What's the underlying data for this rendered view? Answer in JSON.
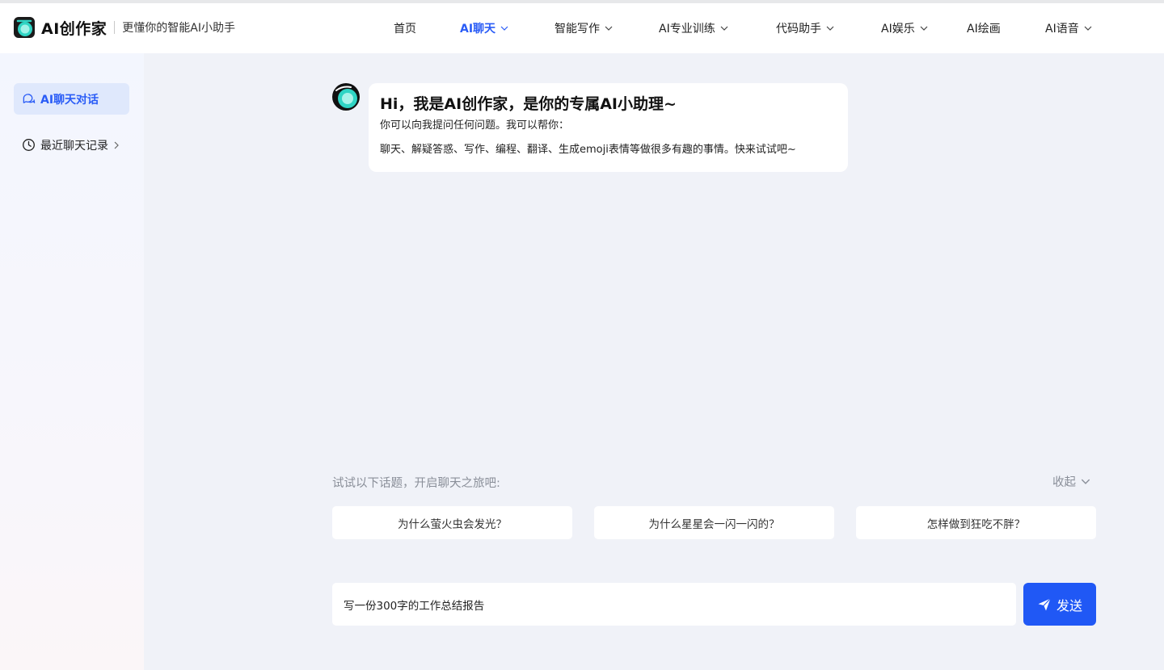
{
  "header": {
    "brand_name": "AI创作家",
    "slogan": "更懂你的智能AI小助手",
    "nav": [
      {
        "label": "首页"
      },
      {
        "label": "AI聊天"
      },
      {
        "label": "智能写作"
      },
      {
        "label": "AI专业训练"
      },
      {
        "label": "代码助手"
      },
      {
        "label": "AI娱乐"
      },
      {
        "label": "AI绘画"
      },
      {
        "label": "AI语音"
      }
    ],
    "active_nav": "AI聊天"
  },
  "sidebar": {
    "chat_label": "AI聊天对话",
    "history_label": "最近聊天记录"
  },
  "chat": {
    "title": "Hi，我是AI创作家，是你的专属AI小助理~",
    "line1": "你可以向我提问任何问题。我可以帮你：",
    "line2": "聊天、解疑答惑、写作、编程、翻译、生成emoji表情等做很多有趣的事情。快来试试吧~"
  },
  "topics": {
    "hint": "试试以下话题，开启聊天之旅吧:",
    "collapse_label": "收起",
    "items": [
      {
        "label": "为什么萤火虫会发光？"
      },
      {
        "label": "为什么星星会一闪一闪的？"
      },
      {
        "label": "怎样做到狂吃不胖？"
      }
    ]
  },
  "composer": {
    "value": "写一份300字的工作总结报告",
    "send_label": "发送"
  },
  "colors": {
    "accent": "#2058f5",
    "page_bg": "#f0f2f8",
    "active_side_bg": "#dfe8fc"
  }
}
